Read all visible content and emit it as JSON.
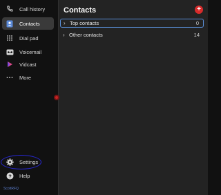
{
  "sidebar": {
    "items": [
      {
        "label": "Call history",
        "icon": "phone-icon"
      },
      {
        "label": "Contacts",
        "icon": "contacts-icon",
        "active": true
      },
      {
        "label": "Dial pad",
        "icon": "dialpad-icon"
      },
      {
        "label": "Voicemail",
        "icon": "voicemail-icon"
      },
      {
        "label": "Vidcast",
        "icon": "vidcast-icon"
      },
      {
        "label": "More",
        "icon": "more-icon"
      }
    ],
    "bottom": [
      {
        "label": "Settings",
        "icon": "gear-icon"
      },
      {
        "label": "Help",
        "icon": "help-icon"
      }
    ],
    "brand": "ScottRFQ"
  },
  "main": {
    "title": "Contacts",
    "add_button_label": "+",
    "groups": [
      {
        "label": "Top contacts",
        "count": "0",
        "selected": true
      },
      {
        "label": "Other contacts",
        "count": "14",
        "selected": false
      }
    ]
  },
  "colors": {
    "accent_red": "#d72b2b",
    "selection_blue": "#5a8fd8",
    "annotation_blue": "#2828d8"
  }
}
